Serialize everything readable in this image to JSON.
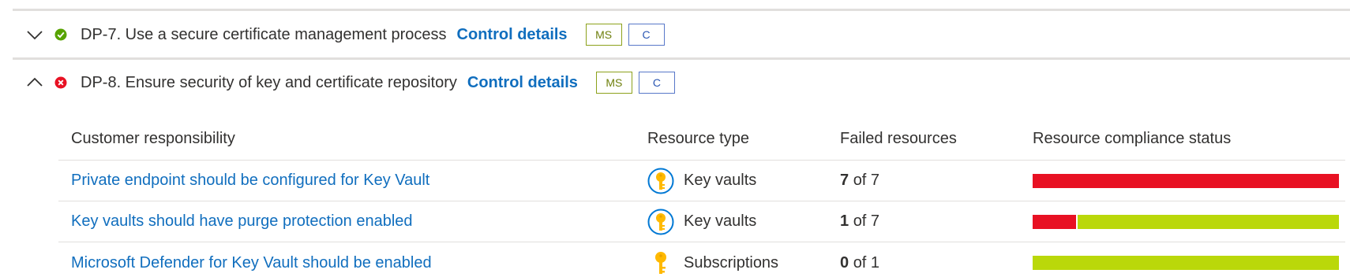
{
  "controls": [
    {
      "status": "passed",
      "status_icon": "check-circle-icon",
      "expanded": false,
      "title": "DP-7. Use a secure certificate management process",
      "details_link": "Control details",
      "badges": [
        "MS",
        "C"
      ]
    },
    {
      "status": "failed",
      "status_icon": "error-circle-icon",
      "expanded": true,
      "title": "DP-8. Ensure security of key and certificate repository",
      "details_link": "Control details",
      "badges": [
        "MS",
        "C"
      ]
    }
  ],
  "table": {
    "headers": [
      "Customer responsibility",
      "Resource type",
      "Failed resources",
      "Resource compliance status"
    ],
    "rows": [
      {
        "policy": "Private endpoint should be configured for Key Vault",
        "resource_icon": "key-vault-icon",
        "resource_type": "Key vaults",
        "failed_count": "7",
        "failed_of": "of 7",
        "failed_fraction": 1.0
      },
      {
        "policy": "Key vaults should have purge protection enabled",
        "resource_icon": "key-vault-icon",
        "resource_type": "Key vaults",
        "failed_count": "1",
        "failed_of": "of 7",
        "failed_fraction": 0.142857
      },
      {
        "policy": "Microsoft Defender for Key Vault should be enabled",
        "resource_icon": "key-icon",
        "resource_type": "Subscriptions",
        "failed_count": "0",
        "failed_of": "of 1",
        "failed_fraction": 0.0
      }
    ]
  },
  "colors": {
    "link": "#106ebe",
    "pass": "#bad80a",
    "fail": "#e81123",
    "ms_badge": "#8ca11b",
    "c_badge": "#5878c9"
  }
}
